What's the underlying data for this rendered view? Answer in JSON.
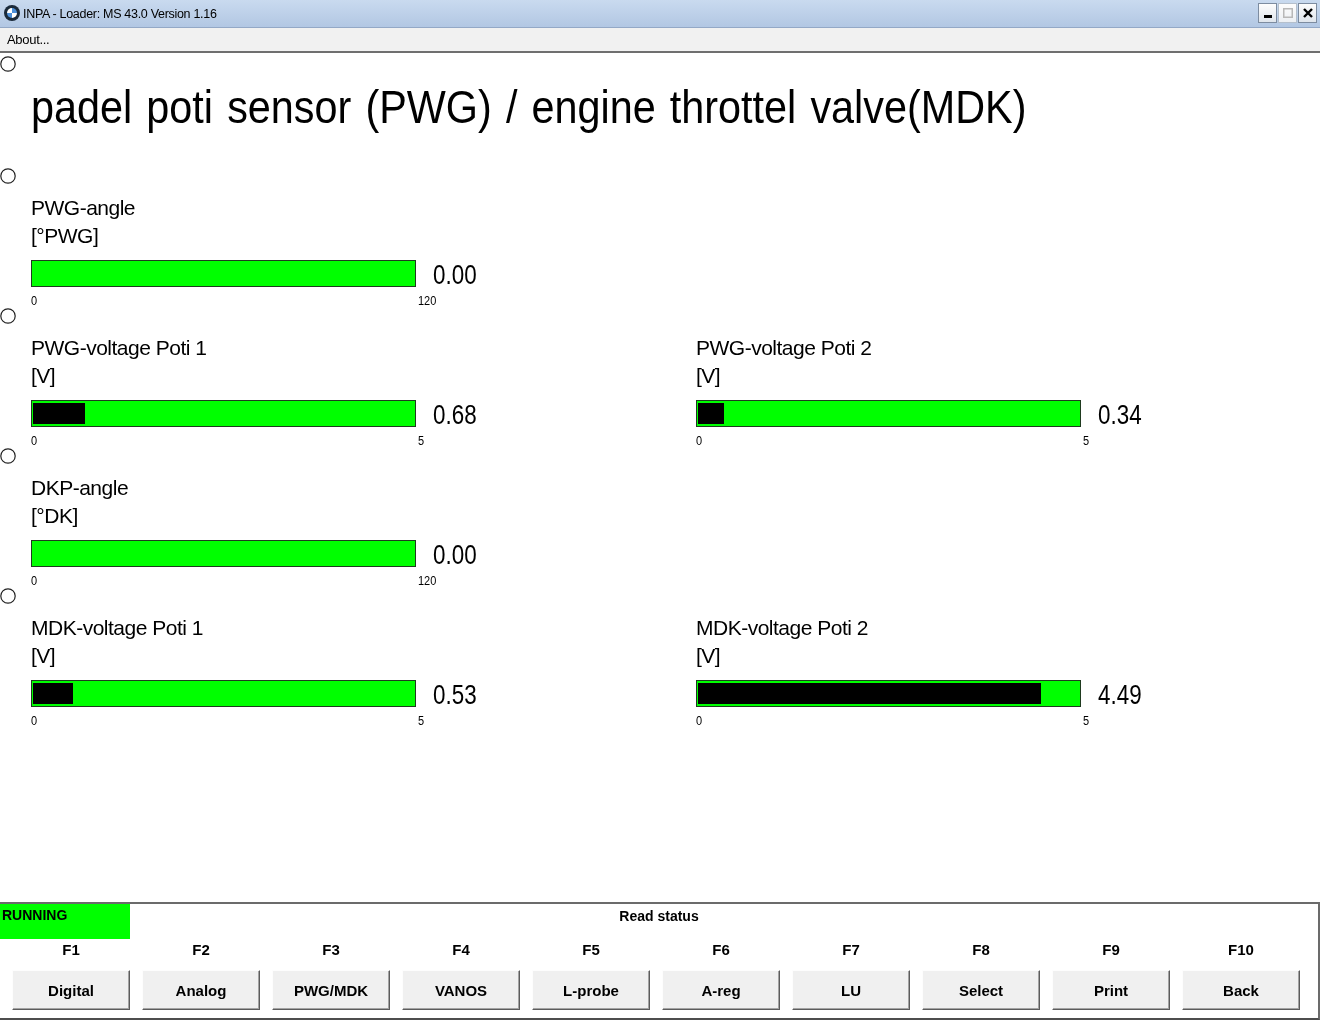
{
  "window": {
    "title": "INPA - Loader: MS 43.0 Version 1.16",
    "controls": [
      {
        "kind": "minimize",
        "disabled": false
      },
      {
        "kind": "maximize",
        "disabled": true
      },
      {
        "kind": "close",
        "disabled": false
      }
    ]
  },
  "menu": [
    "About..."
  ],
  "heading": "padel poti sensor (PWG) / engine throttel valve(MDK)",
  "meter_rows": [
    {
      "meters": [
        {
          "label": "PWG-angle",
          "unit": "[°PWG]",
          "level": 0,
          "reading": "0.00",
          "scale_min": "0",
          "scale_max": "120"
        }
      ]
    },
    {
      "meters": [
        {
          "label": "PWG-voltage Poti 1",
          "unit": "[V]",
          "level": 0.136,
          "reading": "0.68",
          "scale_min": "0",
          "scale_max": "5"
        },
        {
          "label": "PWG-voltage Poti 2",
          "unit": "[V]",
          "level": 0.068,
          "reading": "0.34",
          "scale_min": "0",
          "scale_max": "5"
        }
      ]
    },
    {
      "meters": [
        {
          "label": "DKP-angle",
          "unit": "[°DK]",
          "level": 0,
          "reading": "0.00",
          "scale_min": "0",
          "scale_max": "120"
        }
      ]
    },
    {
      "meters": [
        {
          "label": "MDK-voltage Poti 1",
          "unit": "[V]",
          "level": 0.106,
          "reading": "0.53",
          "scale_min": "0",
          "scale_max": "5"
        },
        {
          "label": "MDK-voltage Poti 2",
          "unit": "[V]",
          "level": 0.898,
          "reading": "4.49",
          "scale_min": "0",
          "scale_max": "5"
        }
      ]
    }
  ],
  "status_bar": {
    "status": "RUNNING",
    "message": "Read status"
  },
  "function_keys": [
    {
      "key": "F1",
      "label": "Digital"
    },
    {
      "key": "F2",
      "label": "Analog"
    },
    {
      "key": "F3",
      "label": "PWG/MDK"
    },
    {
      "key": "F4",
      "label": "VANOS"
    },
    {
      "key": "F5",
      "label": "L-probe"
    },
    {
      "key": "F6",
      "label": "A-reg"
    },
    {
      "key": "F7",
      "label": "LU"
    },
    {
      "key": "F8",
      "label": "Select"
    },
    {
      "key": "F9",
      "label": "Print"
    },
    {
      "key": "F10",
      "label": "Back"
    }
  ]
}
